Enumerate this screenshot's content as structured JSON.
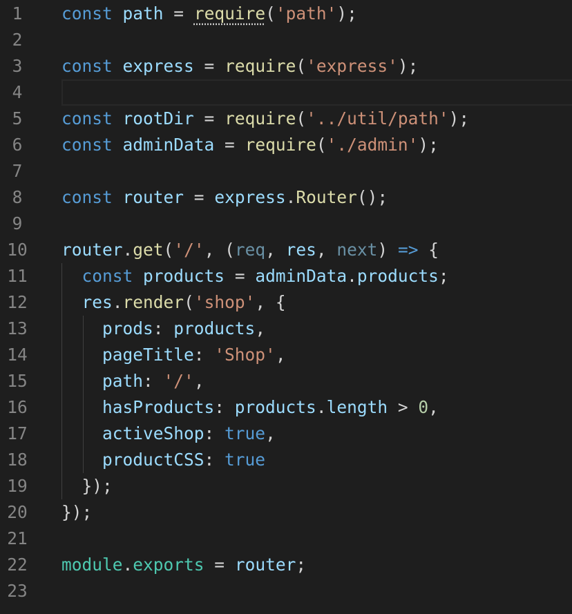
{
  "editor": {
    "colors": {
      "background": "#1e1e1e",
      "line_number": "#858585",
      "keyword": "#569cd6",
      "variable": "#9cdcfe",
      "function": "#dcdcaa",
      "string": "#ce9178",
      "number": "#b5cea8",
      "punctuation": "#d4d4d4",
      "module": "#4ec9b0"
    },
    "current_line": 4,
    "lines": [
      {
        "n": "1",
        "tokens": [
          [
            "kw",
            "const"
          ],
          [
            "pun",
            " "
          ],
          [
            "var",
            "path"
          ],
          [
            "pun",
            " = "
          ],
          [
            "fn squig",
            "require"
          ],
          [
            "pun",
            "("
          ],
          [
            "str",
            "'path'"
          ],
          [
            "pun",
            ");"
          ]
        ]
      },
      {
        "n": "2",
        "tokens": []
      },
      {
        "n": "3",
        "tokens": [
          [
            "kw",
            "const"
          ],
          [
            "pun",
            " "
          ],
          [
            "var",
            "express"
          ],
          [
            "pun",
            " = "
          ],
          [
            "fn",
            "require"
          ],
          [
            "pun",
            "("
          ],
          [
            "str",
            "'express'"
          ],
          [
            "pun",
            ");"
          ]
        ]
      },
      {
        "n": "4",
        "tokens": []
      },
      {
        "n": "5",
        "tokens": [
          [
            "kw",
            "const"
          ],
          [
            "pun",
            " "
          ],
          [
            "var",
            "rootDir"
          ],
          [
            "pun",
            " = "
          ],
          [
            "fn",
            "require"
          ],
          [
            "pun",
            "("
          ],
          [
            "str",
            "'../util/path'"
          ],
          [
            "pun",
            ");"
          ]
        ]
      },
      {
        "n": "6",
        "tokens": [
          [
            "kw",
            "const"
          ],
          [
            "pun",
            " "
          ],
          [
            "var",
            "adminData"
          ],
          [
            "pun",
            " = "
          ],
          [
            "fn",
            "require"
          ],
          [
            "pun",
            "("
          ],
          [
            "str",
            "'./admin'"
          ],
          [
            "pun",
            ");"
          ]
        ]
      },
      {
        "n": "7",
        "tokens": []
      },
      {
        "n": "8",
        "tokens": [
          [
            "kw",
            "const"
          ],
          [
            "pun",
            " "
          ],
          [
            "var",
            "router"
          ],
          [
            "pun",
            " = "
          ],
          [
            "var",
            "express"
          ],
          [
            "pun",
            "."
          ],
          [
            "fn",
            "Router"
          ],
          [
            "pun",
            "();"
          ]
        ]
      },
      {
        "n": "9",
        "tokens": []
      },
      {
        "n": "10",
        "tokens": [
          [
            "var",
            "router"
          ],
          [
            "pun",
            "."
          ],
          [
            "fn",
            "get"
          ],
          [
            "pun",
            "("
          ],
          [
            "str",
            "'/'"
          ],
          [
            "pun",
            ", ("
          ],
          [
            "param",
            "req"
          ],
          [
            "pun",
            ", "
          ],
          [
            "var",
            "res"
          ],
          [
            "pun",
            ", "
          ],
          [
            "param",
            "next"
          ],
          [
            "pun",
            ") "
          ],
          [
            "kw",
            "=>"
          ],
          [
            "pun",
            " {"
          ]
        ]
      },
      {
        "n": "11",
        "tokens": [
          [
            "pun",
            "  "
          ],
          [
            "kw",
            "const"
          ],
          [
            "pun",
            " "
          ],
          [
            "var",
            "products"
          ],
          [
            "pun",
            " = "
          ],
          [
            "var",
            "adminData"
          ],
          [
            "pun",
            "."
          ],
          [
            "var",
            "products"
          ],
          [
            "pun",
            ";"
          ]
        ]
      },
      {
        "n": "12",
        "tokens": [
          [
            "pun",
            "  "
          ],
          [
            "var",
            "res"
          ],
          [
            "pun",
            "."
          ],
          [
            "fn",
            "render"
          ],
          [
            "pun",
            "("
          ],
          [
            "str",
            "'shop'"
          ],
          [
            "pun",
            ", {"
          ]
        ]
      },
      {
        "n": "13",
        "tokens": [
          [
            "pun",
            "    "
          ],
          [
            "var",
            "prods"
          ],
          [
            "pun",
            ": "
          ],
          [
            "var",
            "products"
          ],
          [
            "pun",
            ","
          ]
        ]
      },
      {
        "n": "14",
        "tokens": [
          [
            "pun",
            "    "
          ],
          [
            "var",
            "pageTitle"
          ],
          [
            "pun",
            ": "
          ],
          [
            "str",
            "'Shop'"
          ],
          [
            "pun",
            ","
          ]
        ]
      },
      {
        "n": "15",
        "tokens": [
          [
            "pun",
            "    "
          ],
          [
            "var",
            "path"
          ],
          [
            "pun",
            ": "
          ],
          [
            "str",
            "'/'"
          ],
          [
            "pun",
            ","
          ]
        ]
      },
      {
        "n": "16",
        "tokens": [
          [
            "pun",
            "    "
          ],
          [
            "var",
            "hasProducts"
          ],
          [
            "pun",
            ": "
          ],
          [
            "var",
            "products"
          ],
          [
            "pun",
            "."
          ],
          [
            "var",
            "length"
          ],
          [
            "pun",
            " > "
          ],
          [
            "num",
            "0"
          ],
          [
            "pun",
            ","
          ]
        ]
      },
      {
        "n": "17",
        "tokens": [
          [
            "pun",
            "    "
          ],
          [
            "var",
            "activeShop"
          ],
          [
            "pun",
            ": "
          ],
          [
            "kw",
            "true"
          ],
          [
            "pun",
            ","
          ]
        ]
      },
      {
        "n": "18",
        "tokens": [
          [
            "pun",
            "    "
          ],
          [
            "var",
            "productCSS"
          ],
          [
            "pun",
            ": "
          ],
          [
            "kw",
            "true"
          ]
        ]
      },
      {
        "n": "19",
        "tokens": [
          [
            "pun",
            "  });"
          ]
        ]
      },
      {
        "n": "20",
        "tokens": [
          [
            "pun",
            "});"
          ]
        ]
      },
      {
        "n": "21",
        "tokens": []
      },
      {
        "n": "22",
        "tokens": [
          [
            "mod",
            "module"
          ],
          [
            "pun",
            "."
          ],
          [
            "mod",
            "exports"
          ],
          [
            "pun",
            " = "
          ],
          [
            "var",
            "router"
          ],
          [
            "pun",
            ";"
          ]
        ]
      },
      {
        "n": "23",
        "tokens": []
      }
    ]
  }
}
